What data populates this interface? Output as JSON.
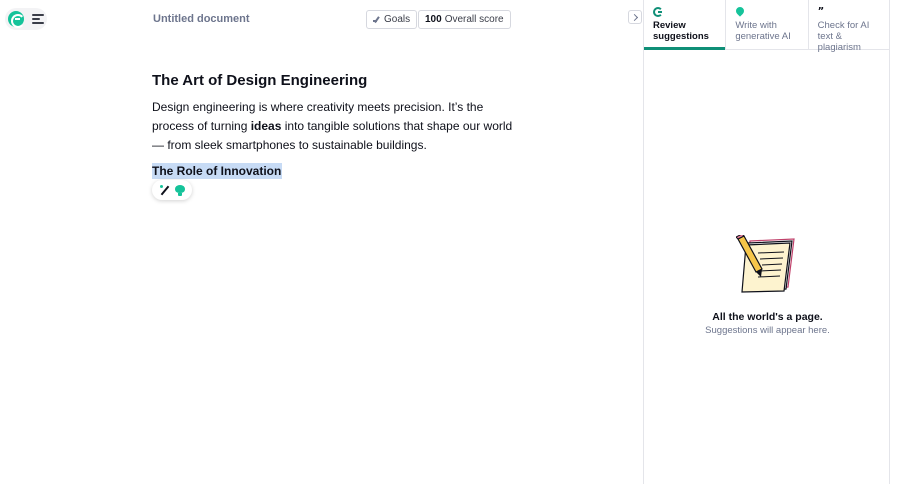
{
  "app": {
    "document_title": "Untitled document"
  },
  "toolbar": {
    "goals_label": "Goals",
    "score_value": "100",
    "score_label": "Overall score"
  },
  "document": {
    "heading": "The Art of Design Engineering",
    "paragraph_part1": "Design engineering is where creativity meets precision. It’s the process of turning ",
    "paragraph_bold": "ideas",
    "paragraph_part2": " into tangible solutions that shape our world — from sleek smartphones to sustainable buildings.",
    "subheading": "The Role of Innovation"
  },
  "panel": {
    "tabs": [
      {
        "label_line1": "Review",
        "label_line2": "suggestions",
        "icon": "grammarly-g-icon",
        "active": true
      },
      {
        "label_line1": "Write with",
        "label_line2": "generative AI",
        "icon": "ai-pin-icon",
        "active": false
      },
      {
        "label_line1": "Check for AI",
        "label_line2": "text & plagiarism",
        "icon": "quote-icon",
        "active": false
      }
    ],
    "empty_state": {
      "title": "All the world's a page.",
      "subtitle": "Suggestions will appear here."
    }
  },
  "colors": {
    "brand_green": "#15c39a",
    "active_tab_underline": "#0f8f77",
    "selection_highlight": "#c7dbf5",
    "muted_text": "#6d758d"
  }
}
